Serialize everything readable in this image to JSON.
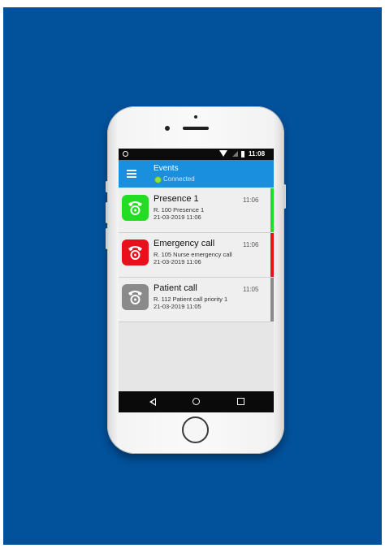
{
  "status_bar": {
    "time": "11:08"
  },
  "app_bar": {
    "title": "Events",
    "connection_status": "Connected",
    "connection_color": "#8ee04a"
  },
  "events": [
    {
      "name": "Presence 1",
      "time": "11:06",
      "room_line": "R. 100 Presence 1",
      "date_line": "21-03-2019 11:06",
      "color": "#22dd22",
      "icon": "phone-call-icon"
    },
    {
      "name": "Emergency call",
      "time": "11:06",
      "room_line": "R. 105 Nurse emergency call",
      "date_line": "21-03-2019 11:06",
      "color": "#e8111b",
      "icon": "phone-call-icon"
    },
    {
      "name": "Patient call",
      "time": "11:05",
      "room_line": "R. 112 Patient call priority 1",
      "date_line": "21-03-2019 11:05",
      "color": "#8a8a8a",
      "icon": "phone-call-icon"
    }
  ],
  "background_color": "#02519b"
}
